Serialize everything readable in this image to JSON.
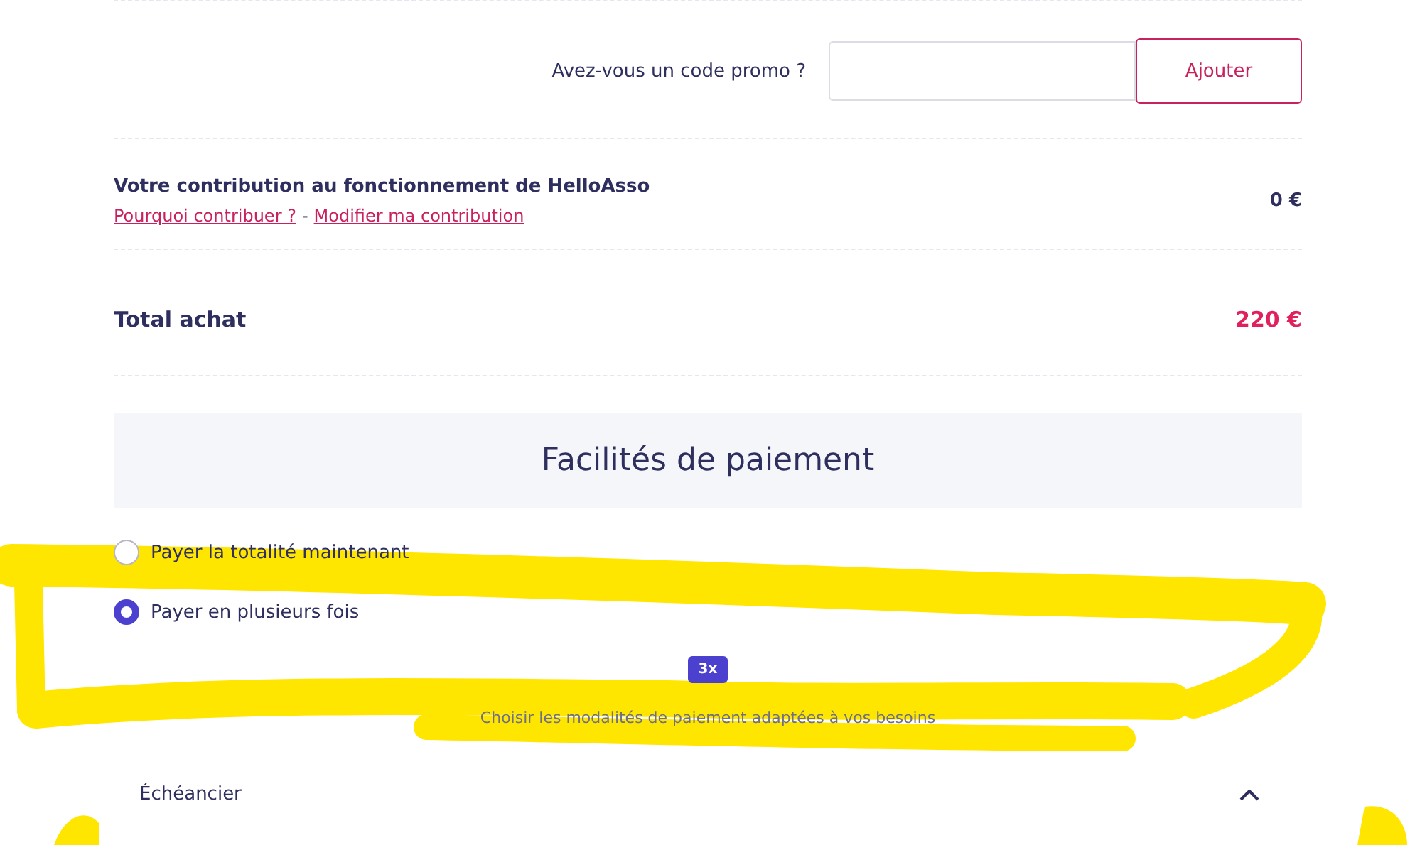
{
  "promo": {
    "label": "Avez-vous un code promo ?",
    "button": "Ajouter"
  },
  "contribution": {
    "title": "Votre contribution au fonctionnement de HelloAsso",
    "links": [
      "Pourquoi contribuer ?",
      "Modifier ma contribution"
    ],
    "separator": "-",
    "amount": "0 €"
  },
  "total": {
    "label": "Total achat",
    "amount": "220 €"
  },
  "payment": {
    "title": "Facilités de paiement",
    "options": [
      {
        "label": "Payer la totalité maintenant",
        "selected": false
      },
      {
        "label": "Payer en plusieurs fois",
        "selected": true
      }
    ],
    "installments_badge": "3x",
    "caption": "Choisir les modalités de paiement adaptées à vos besoins"
  },
  "schedule": {
    "label": "Échéancier",
    "expanded": true
  }
}
